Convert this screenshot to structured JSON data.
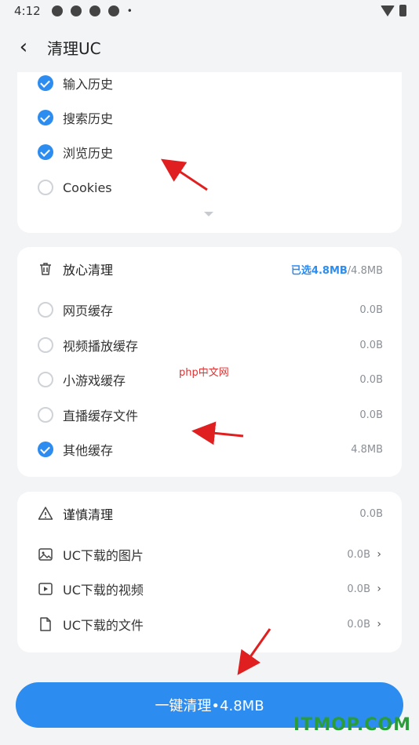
{
  "status_bar": {
    "time": "4:12",
    "dot": "•"
  },
  "header": {
    "title": "清理UC"
  },
  "history_card": {
    "items": [
      {
        "label": "输入历史",
        "checked": true
      },
      {
        "label": "搜索历史",
        "checked": true
      },
      {
        "label": "浏览历史",
        "checked": true
      },
      {
        "label": "Cookies",
        "checked": false
      }
    ]
  },
  "safe_clean": {
    "title": "放心清理",
    "selected": "已选4.8MB",
    "total": "/4.8MB",
    "items": [
      {
        "label": "网页缓存",
        "size": "0.0B",
        "checked": false
      },
      {
        "label": "视频播放缓存",
        "size": "0.0B",
        "checked": false
      },
      {
        "label": "小游戏缓存",
        "size": "0.0B",
        "checked": false
      },
      {
        "label": "直播缓存文件",
        "size": "0.0B",
        "checked": false
      },
      {
        "label": "其他缓存",
        "size": "4.8MB",
        "checked": true
      }
    ]
  },
  "careful_clean": {
    "title": "谨慎清理",
    "size": "0.0B",
    "items": [
      {
        "label": "UC下载的图片",
        "size": "0.0B",
        "icon": "image-icon"
      },
      {
        "label": "UC下载的视频",
        "size": "0.0B",
        "icon": "video-icon"
      },
      {
        "label": "UC下载的文件",
        "size": "0.0B",
        "icon": "file-icon"
      }
    ]
  },
  "watermark": "php中文网",
  "main_button": {
    "label": "一键清理•4.8MB"
  },
  "brand": "ITMOP.COM",
  "colors": {
    "accent": "#2d8cf0",
    "annotation_arrow": "#e02020",
    "brand": "#2a9d3a"
  }
}
